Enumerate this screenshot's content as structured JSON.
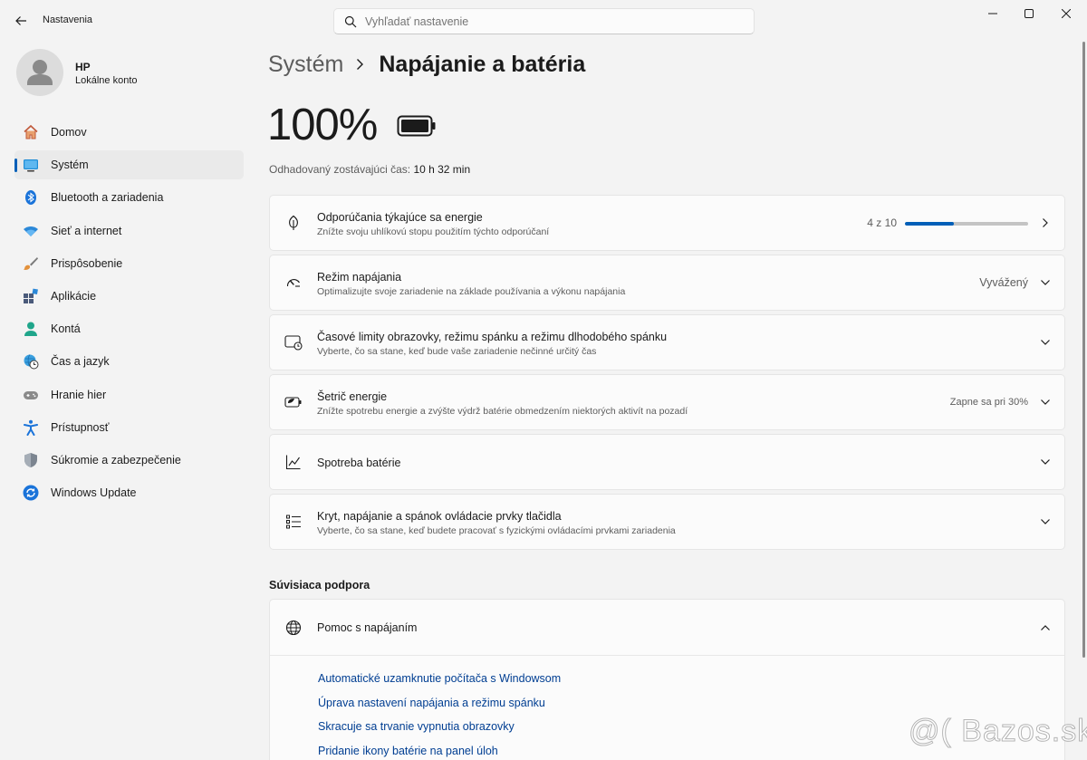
{
  "window": {
    "app_title": "Nastavenia",
    "search_placeholder": "Vyhľadať nastavenie",
    "controls": [
      "minimize-icon",
      "maximize-icon",
      "close-icon"
    ]
  },
  "profile": {
    "name": "HP",
    "account": "Lokálne konto"
  },
  "sidebar": {
    "items": [
      {
        "label": "Domov",
        "icon": "home-icon",
        "active": false
      },
      {
        "label": "Systém",
        "icon": "system-icon",
        "active": true
      },
      {
        "label": "Bluetooth a zariadenia",
        "icon": "bluetooth-icon",
        "active": false
      },
      {
        "label": "Sieť a internet",
        "icon": "wifi-icon",
        "active": false
      },
      {
        "label": "Prispôsobenie",
        "icon": "brush-icon",
        "active": false
      },
      {
        "label": "Aplikácie",
        "icon": "apps-icon",
        "active": false
      },
      {
        "label": "Kontá",
        "icon": "account-icon",
        "active": false
      },
      {
        "label": "Čas a jazyk",
        "icon": "clock-globe-icon",
        "active": false
      },
      {
        "label": "Hranie hier",
        "icon": "gamepad-icon",
        "active": false
      },
      {
        "label": "Prístupnosť",
        "icon": "accessibility-icon",
        "active": false
      },
      {
        "label": "Súkromie a zabezpečenie",
        "icon": "shield-icon",
        "active": false
      },
      {
        "label": "Windows Update",
        "icon": "update-icon",
        "active": false
      }
    ]
  },
  "breadcrumb": {
    "parent": "Systém",
    "current": "Napájanie a batéria"
  },
  "battery": {
    "percent": "100%",
    "estimate_label": "Odhadovaný zostávajúci čas:",
    "estimate_value": "10 h 32 min"
  },
  "cards": [
    {
      "title": "Odporúčania týkajúce sa energie",
      "subtitle": "Znížte svoju uhlíkovú stopu použitím týchto odporúčaní",
      "progress_text": "4 z 10",
      "progress_fraction": 0.4,
      "icon": "leaf-icon"
    },
    {
      "title": "Režim napájania",
      "subtitle": "Optimalizujte svoje zariadenie na základe používania a výkonu napájania",
      "value": "Vyvážený",
      "icon": "power-mode-icon"
    },
    {
      "title": "Časové limity obrazovky, režimu spánku a režimu dlhodobého spánku",
      "subtitle": "Vyberte, čo sa stane, keď bude vaše zariadenie nečinné určitý čas",
      "icon": "screen-sleep-icon"
    },
    {
      "title": "Šetrič energie",
      "subtitle": "Znížte spotrebu energie a zvýšte výdrž batérie obmedzením niektorých aktivít na pozadí",
      "value": "Zapne sa pri 30%",
      "icon": "battery-saver-icon"
    },
    {
      "title": "Spotreba batérie",
      "icon": "chart-line-icon"
    },
    {
      "title": "Kryt, napájanie a spánok ovládacie prvky tlačidla",
      "subtitle": "Vyberte, čo sa stane, keď budete pracovať s fyzickými ovládacími prvkami zariadenia",
      "icon": "list-controls-icon"
    }
  ],
  "related": {
    "section_title": "Súvisiaca podpora",
    "help_title": "Pomoc s napájaním",
    "links": [
      "Automatické uzamknutie počítača s Windowsom",
      "Úprava nastavení napájania a režimu spánku",
      "Skracuje sa trvanie vypnutia obrazovky",
      "Pridanie ikony batérie na panel úloh"
    ]
  },
  "watermark": "@( Bazos.sk"
}
